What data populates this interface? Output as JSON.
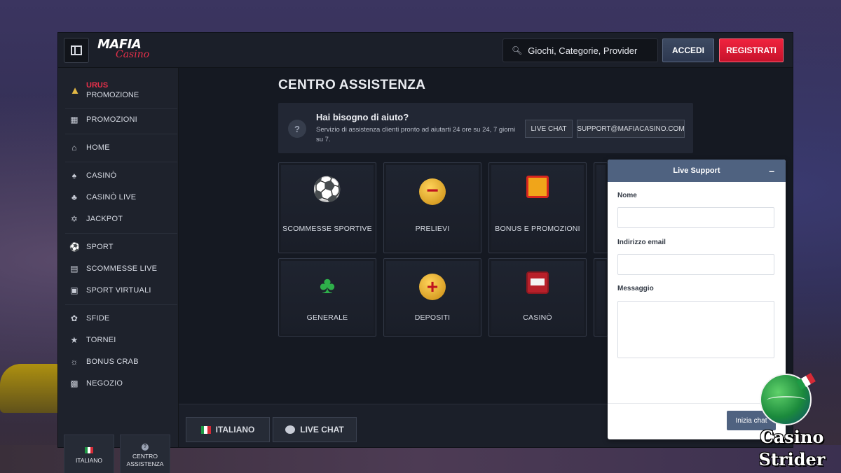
{
  "header": {
    "logo_top": "MAFIA",
    "logo_bottom": "Casino",
    "search_placeholder": "Giochi, Categorie, Provider",
    "login_label": "ACCEDI",
    "register_label": "REGISTRATI"
  },
  "sidebar": {
    "promo_title": "URUS",
    "promo_subtitle": "PROMOZIONE",
    "items": [
      {
        "label": "PROMOZIONI",
        "icon": "gift-icon"
      },
      {
        "label": "HOME",
        "icon": "home-icon"
      },
      {
        "label": "CASINÒ",
        "icon": "spade-icon"
      },
      {
        "label": "CASINÒ LIVE",
        "icon": "cards-icon"
      },
      {
        "label": "JACKPOT",
        "icon": "clover-icon"
      },
      {
        "label": "SPORT",
        "icon": "ball-icon"
      },
      {
        "label": "SCOMMESSE LIVE",
        "icon": "live-icon"
      },
      {
        "label": "SPORT VIRTUALI",
        "icon": "monitor-icon"
      },
      {
        "label": "SFIDE",
        "icon": "badge-icon"
      },
      {
        "label": "TORNEI",
        "icon": "trophy-icon"
      },
      {
        "label": "BONUS CRAB",
        "icon": "crab-icon"
      },
      {
        "label": "NEGOZIO",
        "icon": "store-icon"
      }
    ],
    "lang_label": "ITALIANO",
    "help_label_1": "CENTRO",
    "help_label_2": "ASSISTENZA"
  },
  "main": {
    "title": "CENTRO ASSISTENZA",
    "help": {
      "heading": "Hai bisogno di aiuto?",
      "description": "Servizio di assistenza clienti pronto ad aiutarti 24 ore su 24, 7 giorni su 7.",
      "chat_button": "LIVE CHAT",
      "email_button": "SUPPORT@MAFIACASINO.COM"
    },
    "categories": [
      {
        "label": "SCOMMESSE SPORTIVE",
        "icon": "soccer-ball-icon"
      },
      {
        "label": "PRELIEVI",
        "icon": "coin-minus-icon"
      },
      {
        "label": "BONUS E PROMOZIONI",
        "icon": "gift-box-icon"
      },
      {
        "label": "GENERALE",
        "icon": "four-leaf-clover-icon"
      },
      {
        "label": "DEPOSITI",
        "icon": "coin-plus-icon"
      },
      {
        "label": "CASINÒ",
        "icon": "slot-machine-icon"
      }
    ],
    "bottom_lang": "ITALIANO",
    "bottom_chat": "LIVE CHAT"
  },
  "support": {
    "title": "Live Support",
    "name_label": "Nome",
    "email_label": "Indirizzo email",
    "message_label": "Messaggio",
    "start_button": "Inizia chat"
  },
  "watermark": {
    "line1": "Casino",
    "line2": "Strider"
  },
  "colors": {
    "accent_red": "#e8304a",
    "panel_header": "#4f6280",
    "flag_green": "#1e9a45",
    "flag_white": "#ffffff",
    "flag_red": "#d62a36"
  }
}
